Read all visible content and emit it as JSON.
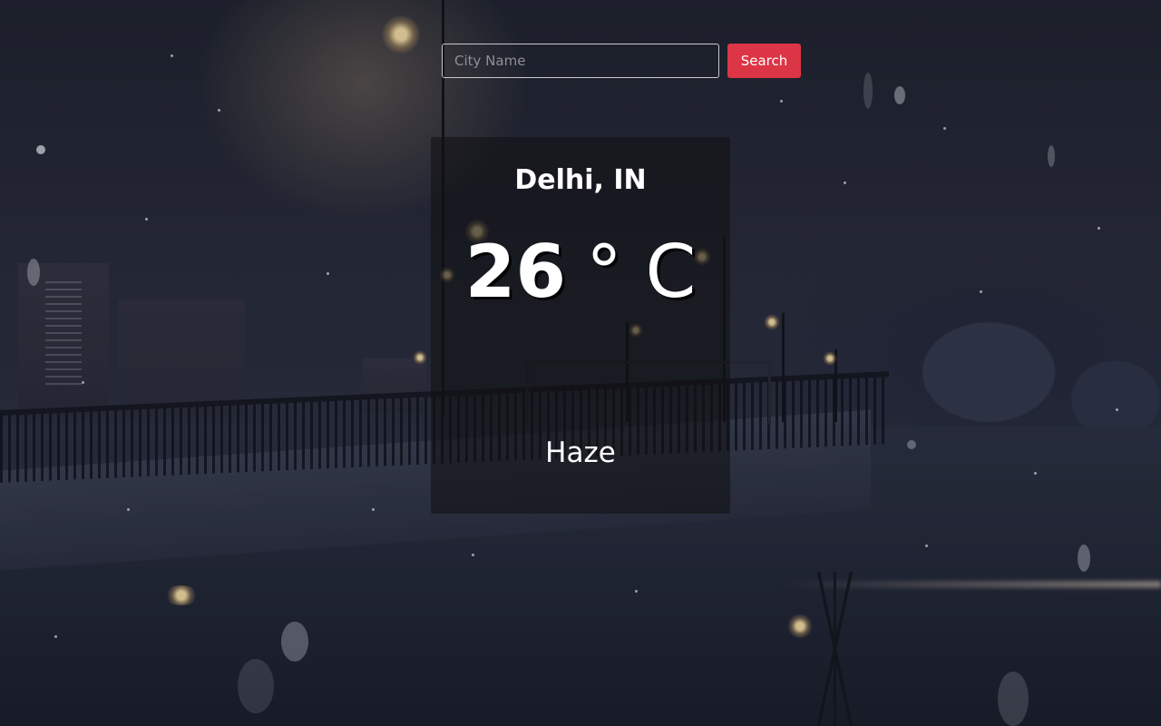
{
  "search": {
    "placeholder": "City Name",
    "value": "",
    "button_label": "Search"
  },
  "weather": {
    "location": "Delhi, IN",
    "temperature": "26",
    "unit": "° C",
    "condition": "Haze"
  },
  "colors": {
    "search_button": "#dc3545",
    "card_background": "rgba(16,16,18,0.55)",
    "text": "#ffffff"
  }
}
